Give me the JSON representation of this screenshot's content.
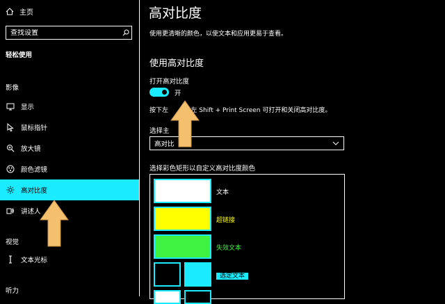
{
  "sidebar": {
    "home_label": "主页",
    "search_placeholder": "查找设置",
    "category": "轻松使用",
    "sections": {
      "vision": "影像",
      "interaction": "视觉",
      "hearing": "听力"
    },
    "items": [
      {
        "label": "显示",
        "icon": "monitor-icon"
      },
      {
        "label": "鼠标指针",
        "icon": "mouse-pointer-icon"
      },
      {
        "label": "放大镜",
        "icon": "magnifier-icon"
      },
      {
        "label": "颜色滤镜",
        "icon": "color-filter-icon"
      },
      {
        "label": "高对比度",
        "icon": "brightness-icon",
        "active": true
      },
      {
        "label": "讲述人",
        "icon": "narrator-icon"
      },
      {
        "label": "文本光标",
        "icon": "text-cursor-icon"
      }
    ]
  },
  "main": {
    "title": "高对比度",
    "description": "使用更清晰的颜色，以使文本和应用更易于查看。",
    "subtitle": "使用高对比度",
    "toggle_label": "打开高对比度",
    "toggle_state": "开",
    "toggle_on": true,
    "hint_pre": "按下左",
    "hint_post": "+ 左 Shift + Print Screen 可打开和关闭高对比度。",
    "theme_label": "选择主",
    "theme_value": "高对比",
    "color_label": "选择彩色矩形以自定义高对比度颜色",
    "swatches": [
      {
        "label": "文本",
        "color": "#ffffff",
        "label_color": "#ffffff"
      },
      {
        "label": "超链接",
        "color": "#ffff00",
        "label_color": "#ffff00"
      },
      {
        "label": "失效文本",
        "color": "#3ff23f",
        "label_color": "#3ff23f"
      },
      {
        "label": "选定文本",
        "color": "#1aebff",
        "label_color": "#000000"
      }
    ]
  },
  "colors": {
    "accent": "#1aebff",
    "background": "#000000",
    "arrow": "#f5c06e"
  }
}
